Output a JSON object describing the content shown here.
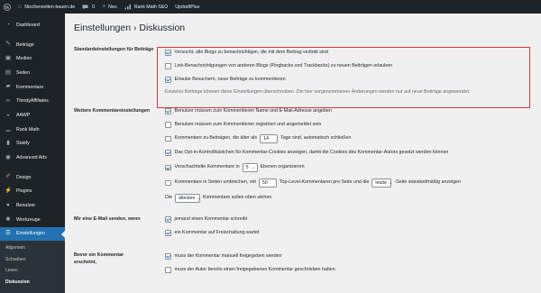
{
  "admin_bar": {
    "wp_logo": "wordpress-logo-icon",
    "site_name": "Nischenseiten-bauen.de",
    "comments_count": "0",
    "new_label": "Neu",
    "rank_math_label": "Rank Math SEO",
    "updraftplus_label": "UpdraftPlus"
  },
  "menu": {
    "items": [
      {
        "label": "Dashboard",
        "icon": "dashboard-icon"
      },
      {
        "label": "Beiträge",
        "icon": "pin-icon"
      },
      {
        "label": "Medien",
        "icon": "media-icon"
      },
      {
        "label": "Seiten",
        "icon": "pages-icon"
      },
      {
        "label": "Kommentare",
        "icon": "comments-icon"
      },
      {
        "label": "ThirstyAffiliates",
        "icon": "link-icon"
      },
      {
        "label": "AAWP",
        "icon": "cart-icon"
      },
      {
        "label": "Rank Math",
        "icon": "chart-icon"
      },
      {
        "label": "Statify",
        "icon": "stats-icon"
      },
      {
        "label": "Advanced Ads",
        "icon": "ads-icon"
      },
      {
        "label": "Design",
        "icon": "brush-icon"
      },
      {
        "label": "Plugins",
        "icon": "plugin-icon"
      },
      {
        "label": "Benutzer",
        "icon": "user-icon"
      },
      {
        "label": "Werkzeuge",
        "icon": "wrench-icon"
      },
      {
        "label": "Einstellungen",
        "icon": "settings-icon"
      }
    ],
    "submenu": [
      "Allgemein",
      "Schreiben",
      "Lesen",
      "Diskussion"
    ]
  },
  "page": {
    "title": "Einstellungen › Diskussion",
    "default_settings": {
      "label": "Standardeinstellungen für Beiträge",
      "opt1": "Versucht, alle Blogs zu benachrichtigen, die mit dem Beitrag verlinkt sind",
      "opt2": "Link-Benachrichtigungen von anderen Blogs (Pingbacks und Trackbacks) zu neuen Beiträgen erlauben",
      "opt3": "Erlaube Besuchern, neue Beiträge zu kommentieren",
      "note": "Einzelne Beiträge können diese Einstellungen überschreiben. Die hier vorgenommenen Änderungen werden nur auf neue Beiträge angewendet."
    },
    "other_settings": {
      "label": "Weitere Kommentareinstellungen",
      "opt_name_email": "Benutzer müssen zum Kommentieren Name und E-Mail-Adresse angeben",
      "opt_registered": "Benutzer müssen zum Kommentieren registriert und angemeldet sein",
      "close_before": "Kommentare zu Beiträgen, die älter als",
      "close_days": "14",
      "close_after": "Tage sind, automatisch schließen",
      "opt_cookies": "Das Opt-in-Kontrollkästchen für Kommentar-Cookies anzeigen, damit die Cookies des Kommentar-Autors gesetzt werden können",
      "threaded_before": "Verschachtelte Kommentare in",
      "threaded_levels": "5",
      "threaded_after": "Ebenen organisieren",
      "paged_before": "Kommentare in Seiten umbrechen, mit",
      "paged_count": "50",
      "paged_middle": "Top-Level-Kommentaren pro Seite und die",
      "paged_page_select": "letzte",
      "paged_after": "-Seite standardmäßig anzeigen",
      "order_before": "Die",
      "order_select": "ältesten",
      "order_after": "Kommentare sollen oben stehen"
    },
    "email_settings": {
      "label": "Mir eine E-Mail senden, wenn",
      "opt1": "jemand einen Kommentar schreibt",
      "opt2": "ein Kommentar auf Freischaltung wartet"
    },
    "before_comment": {
      "label": "Bevor ein Kommentar erscheint,",
      "opt1": "muss der Kommentar manuell freigegeben werden",
      "opt2": "muss der Autor bereits einen freigegebenen Kommentar geschrieben haben"
    }
  },
  "colors": {
    "admin_bar": "#1d2327",
    "menu_bg": "#1d2327",
    "submenu_bg": "#2c3338",
    "accent": "#2271b1",
    "highlight_border": "#d63638",
    "background": "#f0f0f1"
  }
}
